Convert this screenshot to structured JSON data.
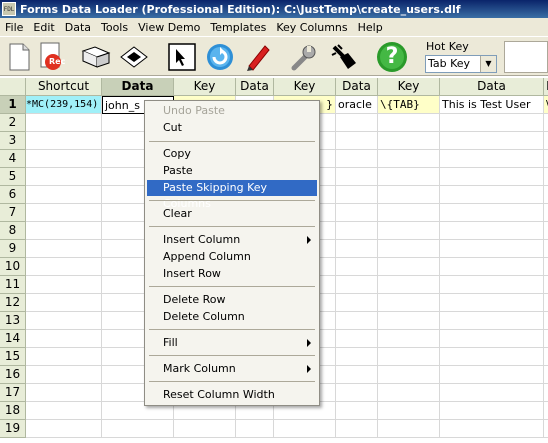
{
  "window": {
    "title": "Forms Data Loader (Professional Edition): C:\\JustTemp\\create_users.dlf",
    "icon_text": "FDL"
  },
  "menubar": [
    "File",
    "Edit",
    "Data",
    "Tools",
    "View Demo",
    "Templates",
    "Key Columns",
    "Help"
  ],
  "toolbar": {
    "icons": [
      "new-file-icon",
      "record-icon",
      "book-icon",
      "diamond-icon",
      "cursor-frame-icon",
      "refresh-icon",
      "pen-icon",
      "wrench-icon",
      "stamp-icon",
      "help-icon"
    ],
    "record_label": "Rec",
    "help_label": "?",
    "hotkey_label": "Hot Key",
    "hotkey_value": "Tab Key"
  },
  "grid": {
    "columns": [
      "Shortcut",
      "Data",
      "Key",
      "Data",
      "Key",
      "Data",
      "Key",
      "Data",
      "Ke"
    ],
    "active_column": 1,
    "rows": [
      "1",
      "2",
      "3",
      "4",
      "5",
      "6",
      "7",
      "8",
      "9",
      "10",
      "11",
      "12",
      "13",
      "14",
      "15",
      "16",
      "17",
      "18",
      "19"
    ],
    "active_row": 0,
    "row1": {
      "shortcut": "*MC(239,154)",
      "data1": "john_s",
      "key3": "}",
      "data3": "oracle",
      "key4": "\\{TAB}",
      "data4": "This is Test User",
      "key5": "\\"
    },
    "colors": {
      "shortcut_bg": "#a0f0f8",
      "key_bg": "#ffffc8"
    }
  },
  "context_menu": {
    "items": {
      "undo_paste": "Undo Paste",
      "cut": "Cut",
      "copy": "Copy",
      "paste": "Paste",
      "paste_skipping": "Paste Skipping Key Columns",
      "clear": "Clear",
      "insert_column": "Insert Column",
      "append_column": "Append Column",
      "insert_row": "Insert Row",
      "delete_row": "Delete Row",
      "delete_column": "Delete Column",
      "fill": "Fill",
      "mark_column": "Mark Column",
      "reset_width": "Reset Column Width"
    },
    "highlight_color": "#316ac5"
  }
}
